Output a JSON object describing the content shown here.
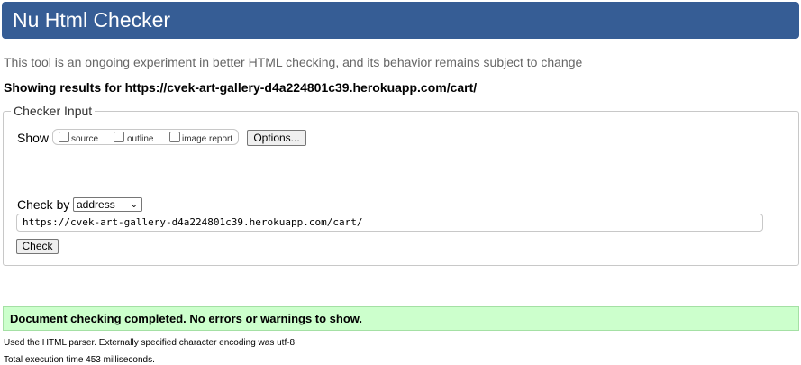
{
  "header": {
    "title": "Nu Html Checker",
    "accent_color": "#365d95"
  },
  "tagline": "This tool is an ongoing experiment in better HTML checking, and its behavior remains subject to change",
  "showing_results": "Showing results for https://cvek-art-gallery-d4a224801c39.herokuapp.com/cart/",
  "checker_input": {
    "legend": "Checker Input",
    "show_label": "Show",
    "options": [
      {
        "label": "source",
        "checked": false
      },
      {
        "label": "outline",
        "checked": false
      },
      {
        "label": "image report",
        "checked": false
      }
    ],
    "options_button": "Options...",
    "check_by_label": "Check by",
    "check_by_selected": "address",
    "url_value": "https://cvek-art-gallery-d4a224801c39.herokuapp.com/cart/",
    "check_button": "Check"
  },
  "result": {
    "message": "Document checking completed. No errors or warnings to show.",
    "color": "#ccffcc"
  },
  "info": {
    "parser": "Used the HTML parser. Externally specified character encoding was utf-8.",
    "execution": "Total execution time 453 milliseconds."
  }
}
